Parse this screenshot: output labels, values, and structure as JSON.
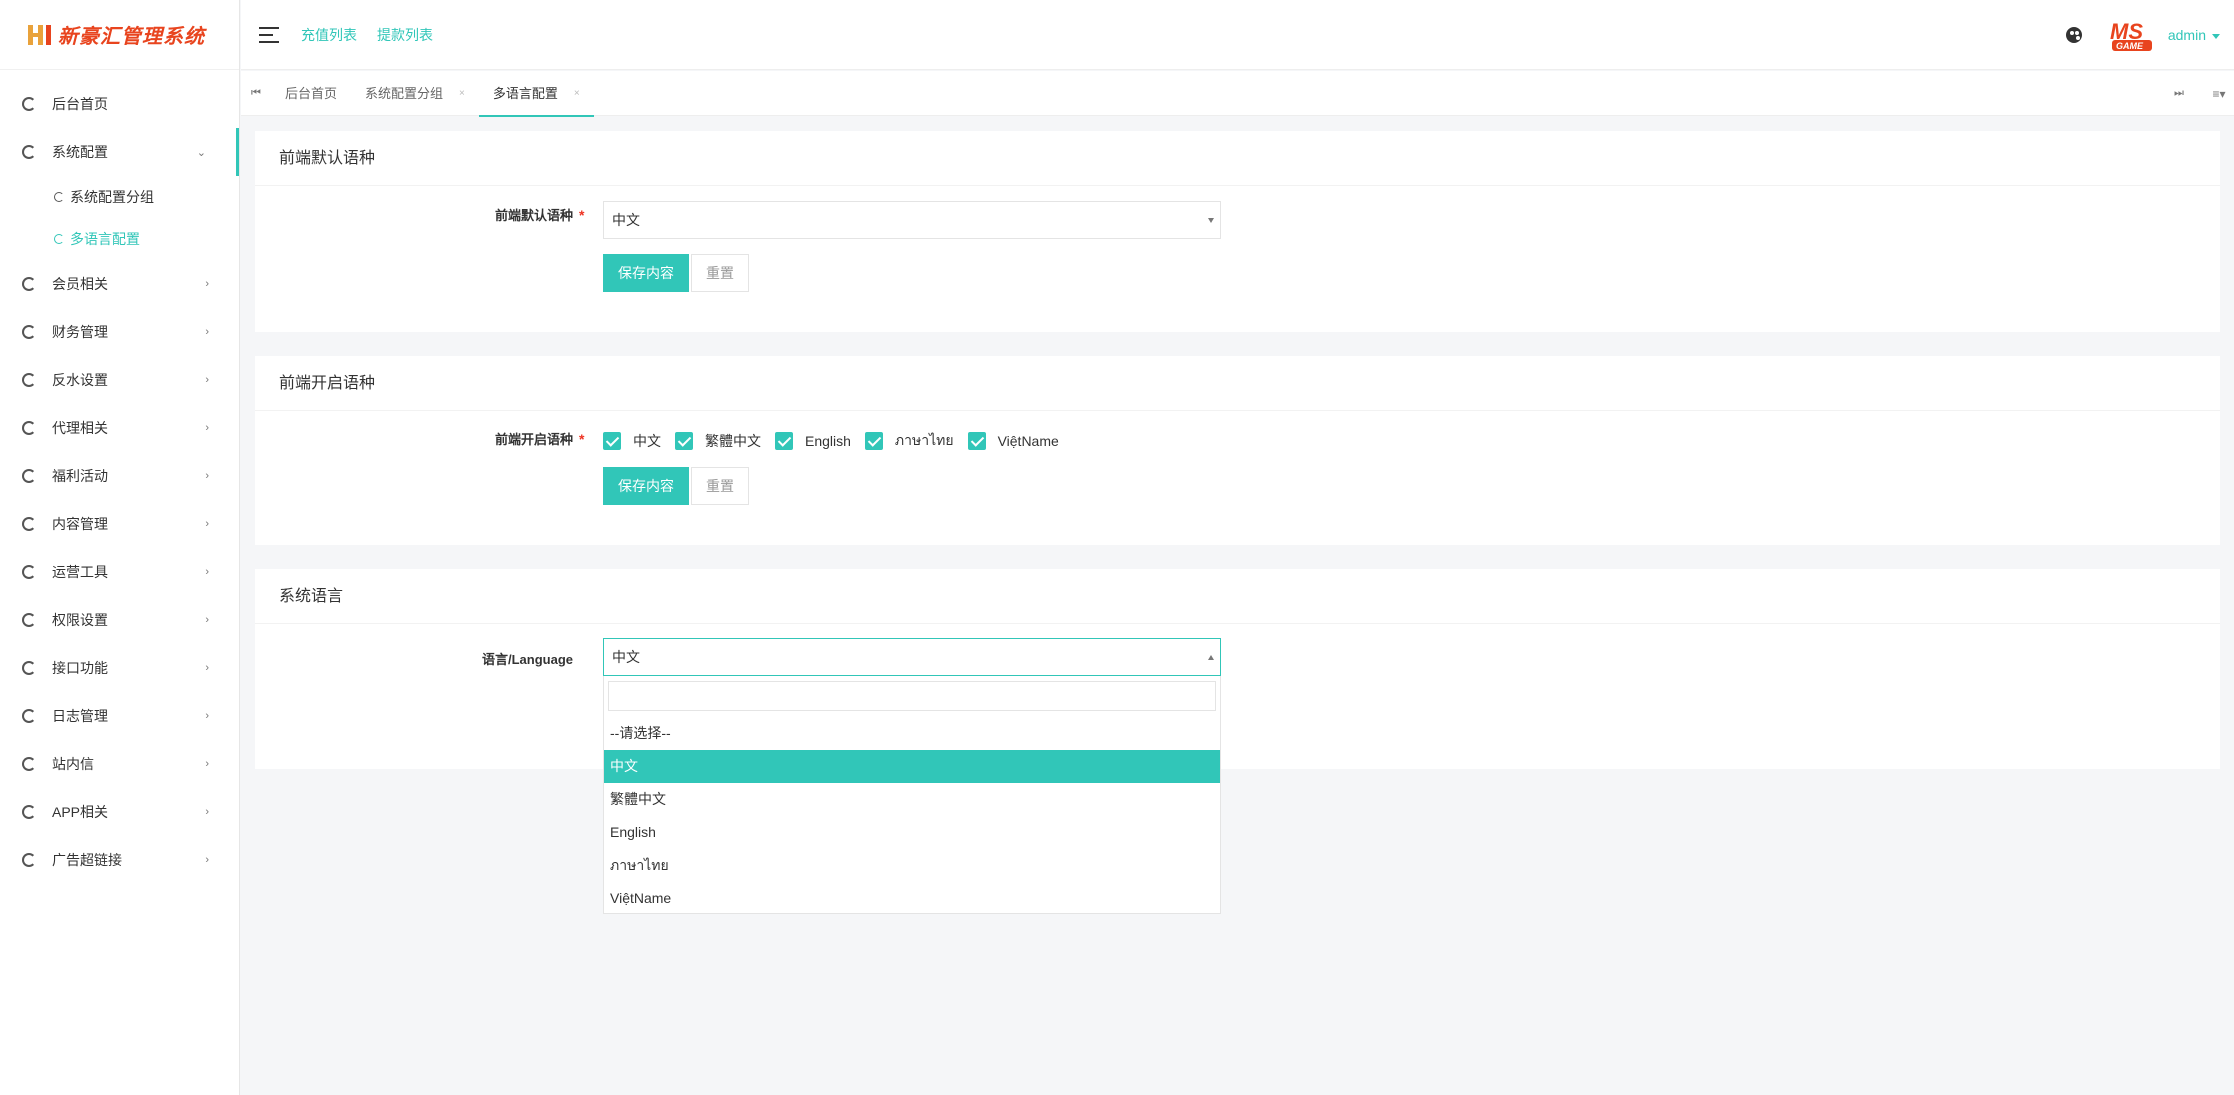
{
  "app": {
    "title": "新豪汇管理系统"
  },
  "sidebar": {
    "items": [
      {
        "label": "后台首页"
      },
      {
        "label": "系统配置",
        "open": true
      },
      {
        "label": "会员相关"
      },
      {
        "label": "财务管理"
      },
      {
        "label": "反水设置"
      },
      {
        "label": "代理相关"
      },
      {
        "label": "福利活动"
      },
      {
        "label": "内容管理"
      },
      {
        "label": "运营工具"
      },
      {
        "label": "权限设置"
      },
      {
        "label": "接口功能"
      },
      {
        "label": "日志管理"
      },
      {
        "label": "站内信"
      },
      {
        "label": "APP相关"
      },
      {
        "label": "广告超链接"
      }
    ],
    "subitems": [
      {
        "label": "系统配置分组"
      },
      {
        "label": "多语言配置"
      }
    ]
  },
  "header": {
    "links": [
      "充值列表",
      "提款列表"
    ],
    "user": "admin",
    "logo_text": "MS GAME"
  },
  "tabs": [
    "后台首页",
    "系统配置分组",
    "多语言配置"
  ],
  "panels": {
    "default_lang": {
      "title": "前端默认语种",
      "label": "前端默认语种",
      "value": "中文",
      "save": "保存内容",
      "reset": "重置"
    },
    "enabled_lang": {
      "title": "前端开启语种",
      "label": "前端开启语种",
      "options": [
        "中文",
        "繁體中文",
        "English",
        "ภาษาไทย",
        "ViệtName"
      ],
      "save": "保存内容",
      "reset": "重置"
    },
    "system_lang": {
      "title": "系统语言",
      "label": "语言/Language",
      "value": "中文",
      "dropdown": [
        "--请选择--",
        "中文",
        "繁體中文",
        "English",
        "ภาษาไทย",
        "ViệtName"
      ]
    }
  },
  "colors": {
    "accent": "#31c6b8",
    "logo": "#e8441e",
    "required": "#ee3322"
  }
}
